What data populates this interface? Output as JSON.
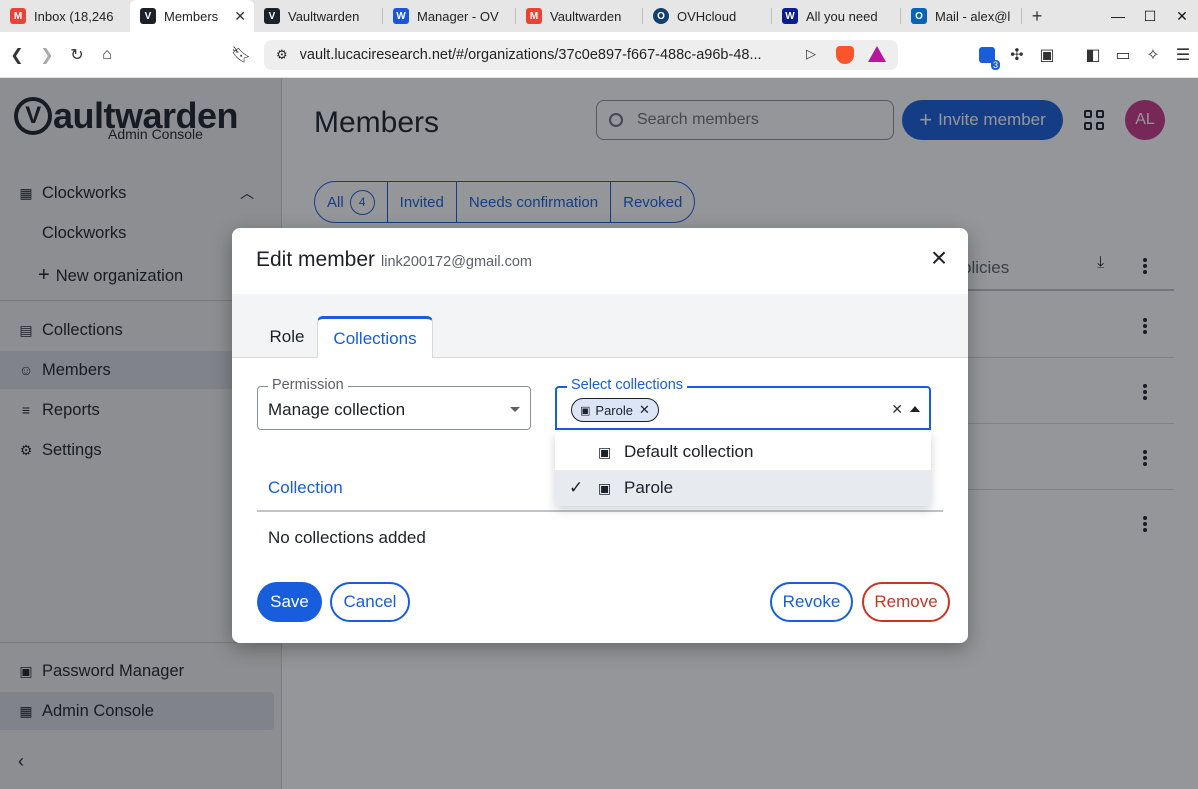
{
  "browser": {
    "tabs": [
      {
        "label": "Inbox (18,246",
        "fav": "M",
        "favColor": "#ea4335"
      },
      {
        "label": "Members",
        "fav": "V",
        "favColor": "#1b2029"
      },
      {
        "label": "Vaultwarden",
        "fav": "V",
        "favColor": "#1b2029"
      },
      {
        "label": "Manager - OV",
        "fav": "W",
        "favColor": "#1a56db"
      },
      {
        "label": "Vaultwarden",
        "fav": "M",
        "favColor": "#ea4335"
      },
      {
        "label": "OVHcloud",
        "fav": "O",
        "favColor": "#123f6d"
      },
      {
        "label": "All you need",
        "fav": "W",
        "favColor": "#0a1f8f"
      },
      {
        "label": "Mail - alex@l",
        "fav": "O",
        "favColor": "#0364b8"
      }
    ],
    "url": "vault.lucaciresearch.net/#/organizations/37c0e897-f667-488c-a96b-48...",
    "ext_badge": "3"
  },
  "sidebar": {
    "logo_word": "aultwarden",
    "logo_letter": "V",
    "logo_sub": "Admin Console",
    "org_name": "Clockworks",
    "org_item": "Clockworks",
    "new_org": "New organization",
    "items": [
      {
        "label": "Collections"
      },
      {
        "label": "Members"
      },
      {
        "label": "Reports"
      },
      {
        "label": "Settings"
      }
    ],
    "password_manager": "Password Manager",
    "admin_console": "Admin Console"
  },
  "main": {
    "title": "Members",
    "search_placeholder": "Search members",
    "invite_label": "Invite member",
    "avatar_initials": "AL",
    "filters": {
      "all": "All",
      "all_count": "4",
      "invited": "Invited",
      "needs_confirmation": "Needs confirmation",
      "revoked": "Revoked"
    },
    "policies_header": "olicies"
  },
  "dialog": {
    "title": "Edit member",
    "subtitle": "link200172@gmail.com",
    "tabs": {
      "role": "Role",
      "collections": "Collections"
    },
    "permission_label": "Permission",
    "permission_value": "Manage collection",
    "select_label": "Select collections",
    "selected_chip": "Parole",
    "options": [
      {
        "label": "Default collection",
        "checked": false
      },
      {
        "label": "Parole",
        "checked": true
      }
    ],
    "collection_header": "Collection",
    "empty_text": "No collections added",
    "buttons": {
      "save": "Save",
      "cancel": "Cancel",
      "revoke": "Revoke",
      "remove": "Remove"
    }
  },
  "colors": {
    "primary": "#175ddc",
    "danger": "#c83522",
    "avatar": "#c83589"
  }
}
